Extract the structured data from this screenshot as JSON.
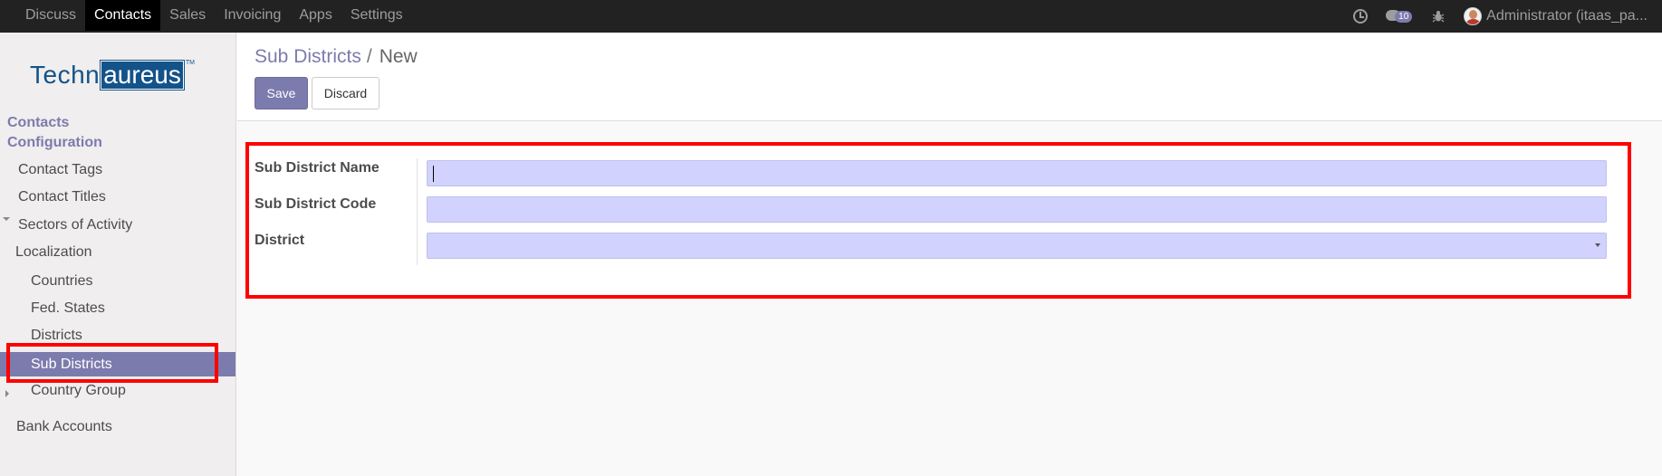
{
  "topbar": {
    "menu": [
      "Discuss",
      "Contacts",
      "Sales",
      "Invoicing",
      "Apps",
      "Settings"
    ],
    "active_menu": "Contacts",
    "chat_badge": "10",
    "user": "Administrator (itaas_pa..."
  },
  "sidebar": {
    "logo_left": "Techn",
    "logo_right": "aureus",
    "logo_tm": "TM",
    "sections": [
      "Contacts",
      "Configuration"
    ],
    "items": {
      "contact_tags": "Contact Tags",
      "contact_titles": "Contact Titles",
      "sectors": "Sectors of Activity",
      "localization": "Localization",
      "countries": "Countries",
      "fed_states": "Fed. States",
      "districts": "Districts",
      "sub_districts": "Sub Districts",
      "country_group": "Country Group",
      "bank_accounts": "Bank Accounts"
    },
    "active_item": "Sub Districts"
  },
  "control": {
    "breadcrumb_parent": "Sub Districts",
    "breadcrumb_separator": "/",
    "breadcrumb_current": "New",
    "save_label": "Save",
    "discard_label": "Discard"
  },
  "form": {
    "fields": [
      {
        "label": "Sub District Name",
        "value": "",
        "type": "text"
      },
      {
        "label": "Sub District Code",
        "value": "",
        "type": "text"
      },
      {
        "label": "District",
        "value": "",
        "type": "select"
      }
    ]
  },
  "colors": {
    "navbar": "#222222",
    "accent": "#7c7bad",
    "input_fill": "#d2d2ff",
    "highlight": "#ff0000",
    "logo": "#13538a"
  }
}
